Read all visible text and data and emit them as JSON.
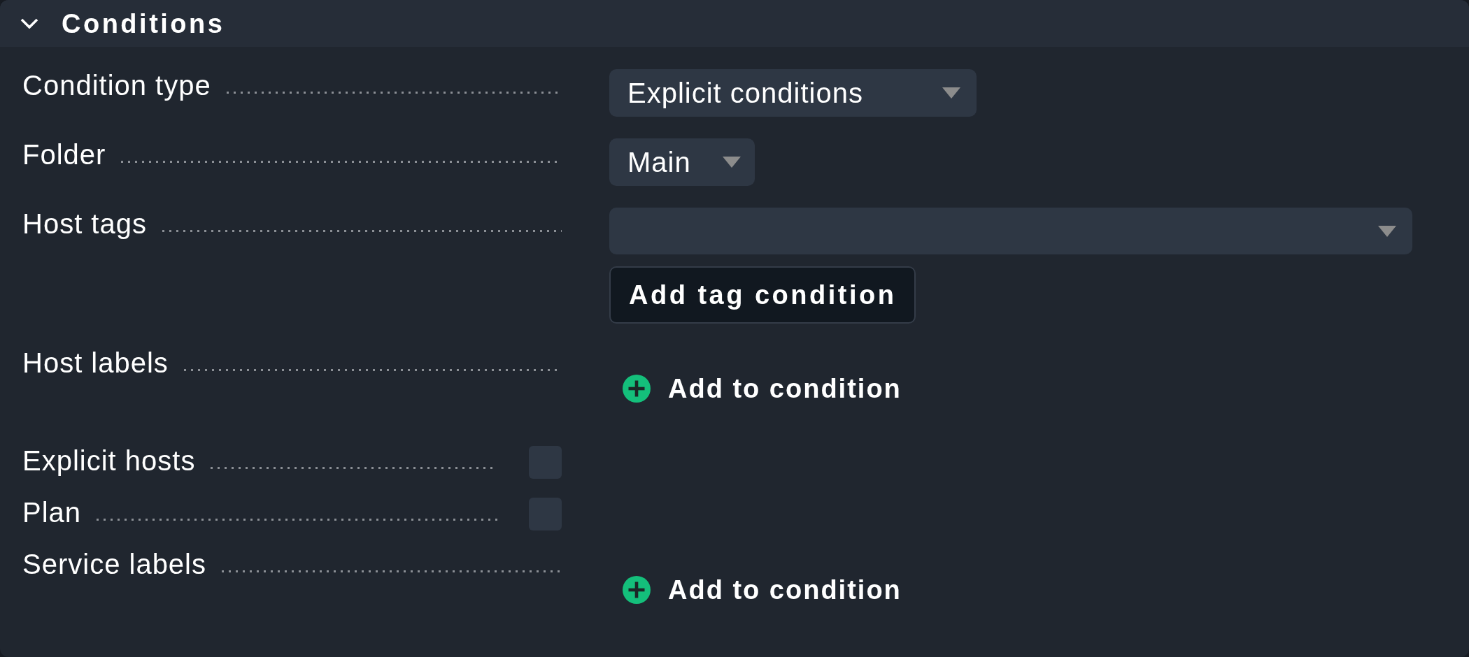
{
  "section": {
    "title": "Conditions",
    "expanded": true
  },
  "rows": [
    {
      "kind": "select",
      "label": "Condition type",
      "value": "Explicit conditions"
    },
    {
      "kind": "select",
      "label": "Folder",
      "value": "Main"
    },
    {
      "kind": "tags",
      "label": "Host tags",
      "button": "Add tag condition"
    },
    {
      "kind": "labels",
      "label": "Host labels",
      "link": "Add to condition"
    },
    {
      "kind": "checkbox",
      "label": "Explicit hosts",
      "checked": false
    },
    {
      "kind": "checkbox",
      "label": "Plan",
      "checked": false
    },
    {
      "kind": "labels",
      "label": "Service labels",
      "link": "Add to condition"
    }
  ]
}
